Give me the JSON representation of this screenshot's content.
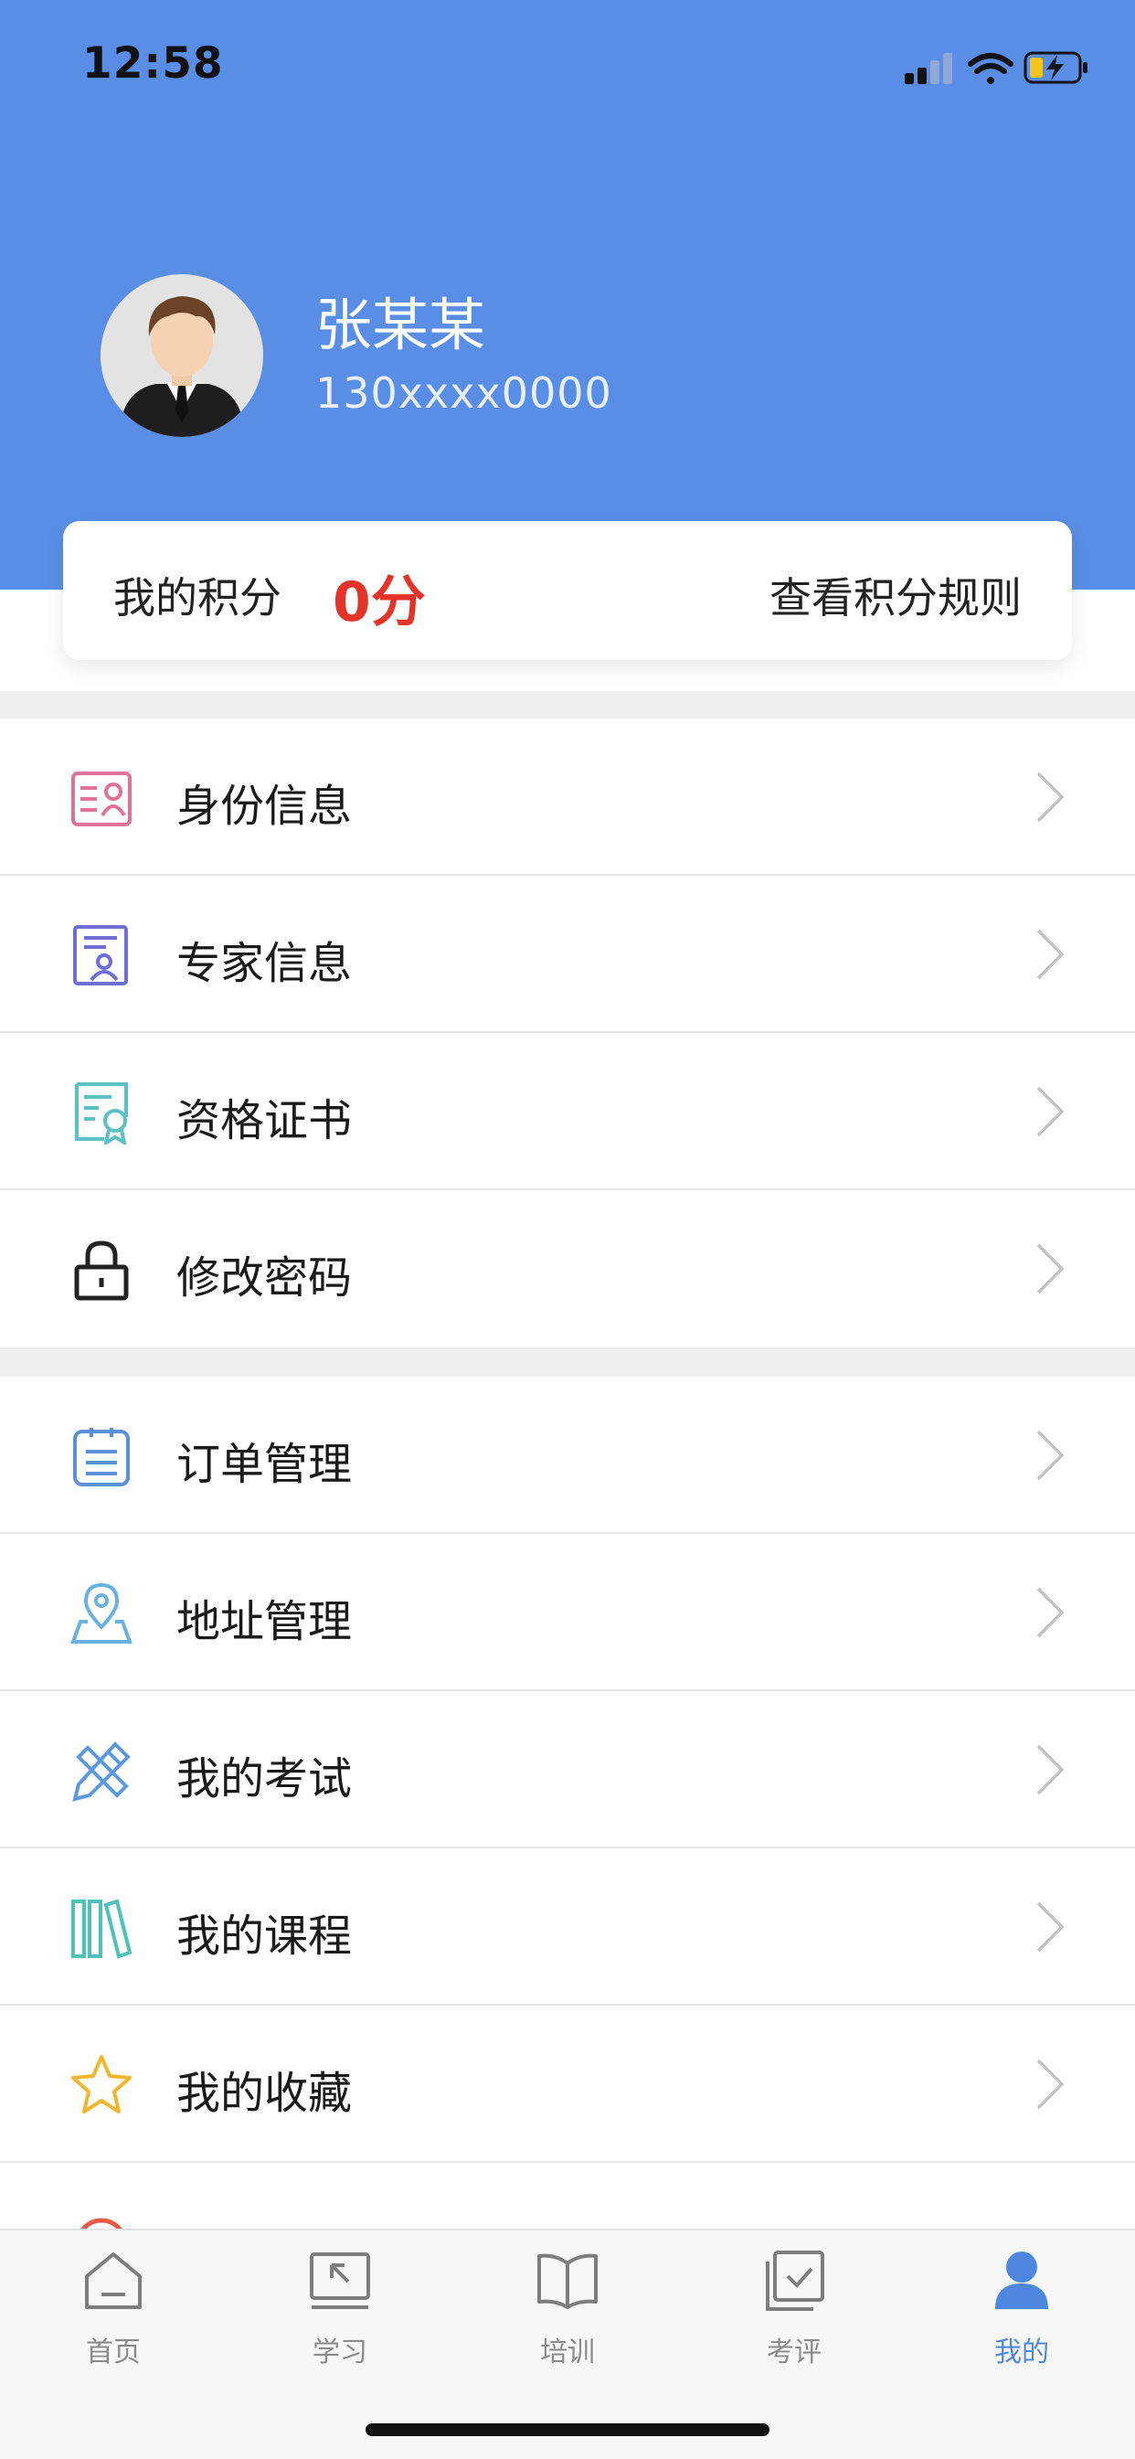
{
  "status_bar": {
    "time": "12:58",
    "icons": [
      "signal-icon",
      "wifi-icon",
      "battery-charging-icon"
    ]
  },
  "profile": {
    "name": "张某某",
    "phone": "130xxxx0000",
    "avatar": "user-avatar-icon"
  },
  "points": {
    "label": "我的积分",
    "value": "0分",
    "rules_link": "查看积分规则"
  },
  "menu_group1": [
    {
      "label": "身份信息",
      "icon": "id-card-icon"
    },
    {
      "label": "专家信息",
      "icon": "expert-icon"
    },
    {
      "label": "资格证书",
      "icon": "certificate-icon"
    },
    {
      "label": "修改密码",
      "icon": "lock-icon"
    }
  ],
  "menu_group2": [
    {
      "label": "订单管理",
      "icon": "order-list-icon"
    },
    {
      "label": "地址管理",
      "icon": "map-pin-icon"
    },
    {
      "label": "我的考试",
      "icon": "pencil-ruler-icon"
    },
    {
      "label": "我的课程",
      "icon": "books-icon"
    },
    {
      "label": "我的收藏",
      "icon": "star-icon"
    }
  ],
  "tabbar": [
    {
      "label": "首页",
      "icon": "home-icon",
      "active": false
    },
    {
      "label": "学习",
      "icon": "study-icon",
      "active": false
    },
    {
      "label": "培训",
      "icon": "book-open-icon",
      "active": false
    },
    {
      "label": "考评",
      "icon": "evaluate-icon",
      "active": false
    },
    {
      "label": "我的",
      "icon": "person-icon",
      "active": true
    }
  ],
  "colors": {
    "header_bg": "#5a8ee6",
    "accent": "#4f87e0",
    "points_red": "#e4342a"
  }
}
